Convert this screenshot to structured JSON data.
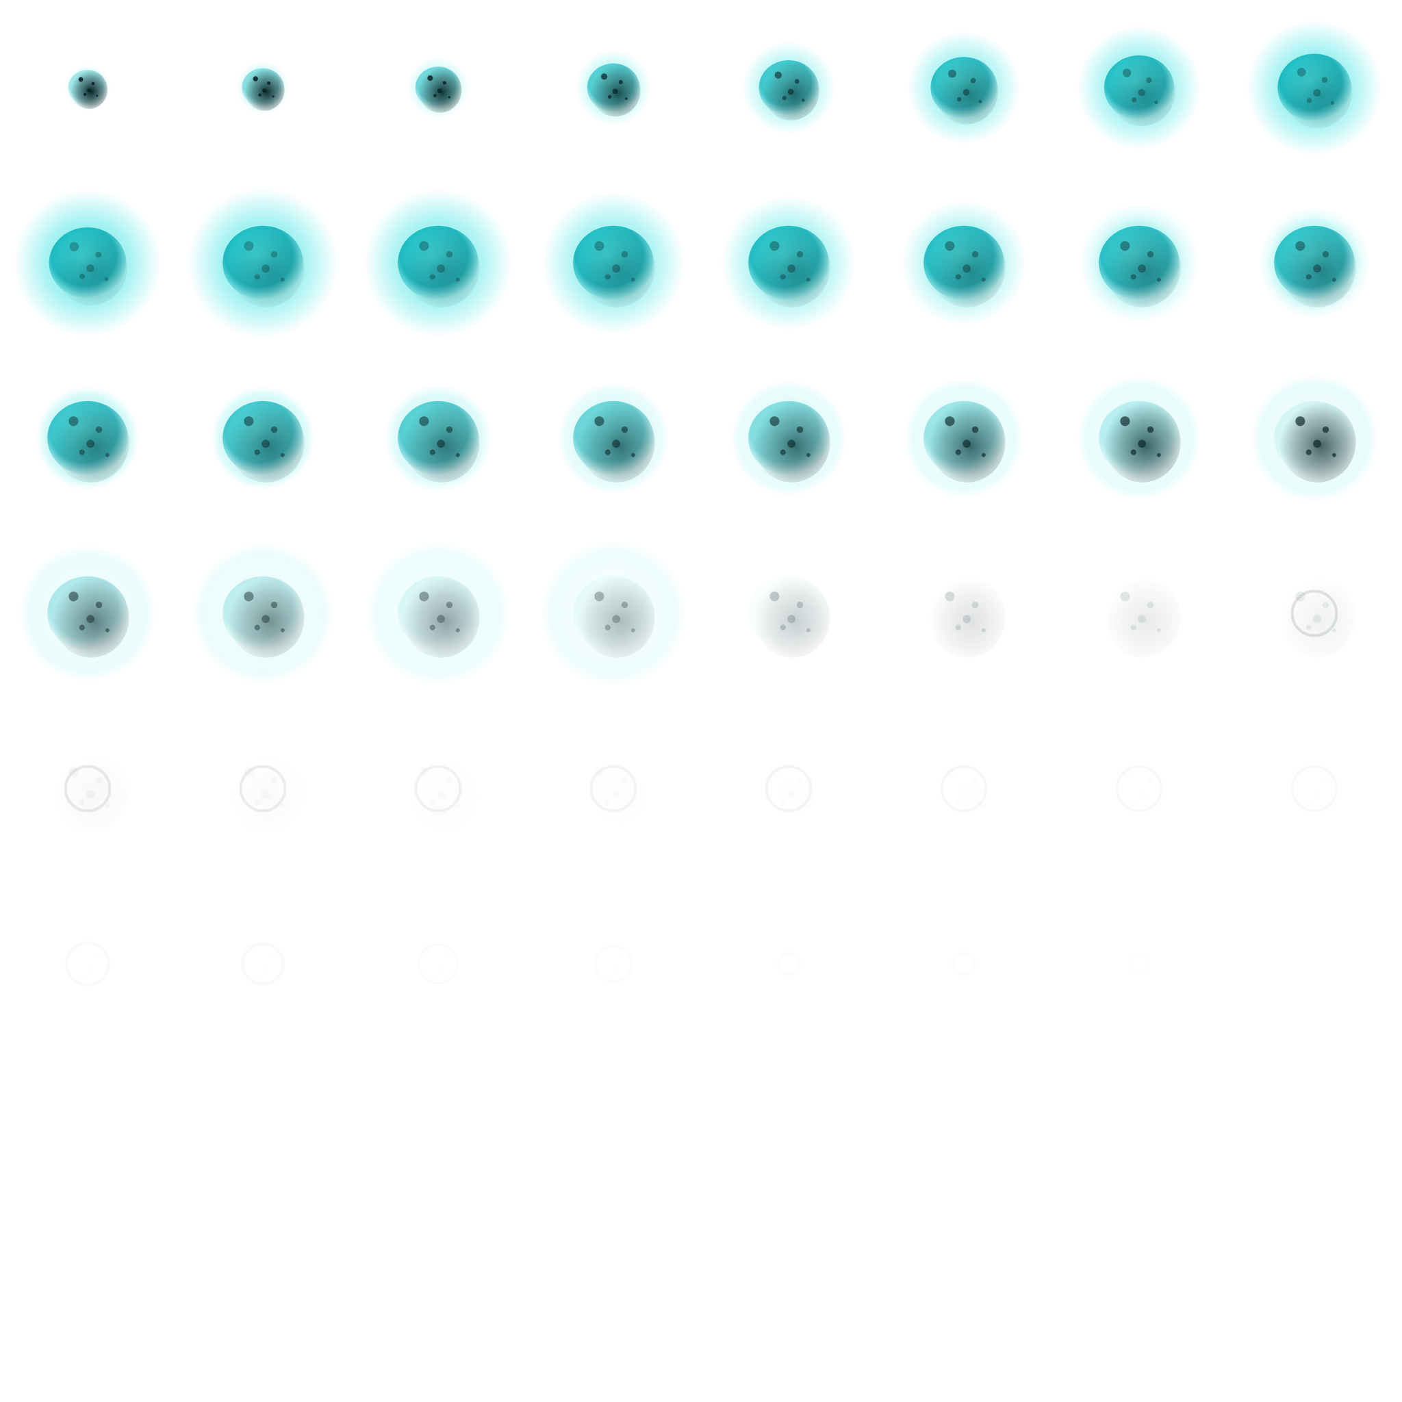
{
  "sprite_sheet": {
    "grid": {
      "columns": 8,
      "rows": 8
    },
    "frame_count": 55,
    "colors": {
      "glow": "#3fe3e3",
      "core": "#1fb8bf",
      "dark": "#0a2326",
      "smoke": "#2b3a3c",
      "background": "#ffffff"
    },
    "frames": [
      {
        "index": 0,
        "core": 0.22,
        "glow": 0.15,
        "ring": 0.0,
        "teal": 0.35,
        "dark": 1.0,
        "opacity": 1.0
      },
      {
        "index": 1,
        "core": 0.24,
        "glow": 0.2,
        "ring": 0.0,
        "teal": 0.45,
        "dark": 0.95,
        "opacity": 1.0
      },
      {
        "index": 2,
        "core": 0.26,
        "glow": 0.25,
        "ring": 0.0,
        "teal": 0.55,
        "dark": 0.9,
        "opacity": 1.0
      },
      {
        "index": 3,
        "core": 0.3,
        "glow": 0.32,
        "ring": 0.0,
        "teal": 0.7,
        "dark": 0.75,
        "opacity": 1.0
      },
      {
        "index": 4,
        "core": 0.34,
        "glow": 0.4,
        "ring": 0.0,
        "teal": 0.8,
        "dark": 0.6,
        "opacity": 1.0
      },
      {
        "index": 5,
        "core": 0.38,
        "glow": 0.5,
        "ring": 0.0,
        "teal": 0.9,
        "dark": 0.45,
        "opacity": 1.0
      },
      {
        "index": 6,
        "core": 0.4,
        "glow": 0.55,
        "ring": 0.0,
        "teal": 0.95,
        "dark": 0.35,
        "opacity": 1.0
      },
      {
        "index": 7,
        "core": 0.42,
        "glow": 0.6,
        "ring": 0.0,
        "teal": 1.0,
        "dark": 0.3,
        "opacity": 1.0
      },
      {
        "index": 8,
        "core": 0.44,
        "glow": 0.65,
        "ring": 0.0,
        "teal": 1.0,
        "dark": 0.28,
        "opacity": 1.0
      },
      {
        "index": 9,
        "core": 0.46,
        "glow": 0.62,
        "ring": 0.0,
        "teal": 1.0,
        "dark": 0.28,
        "opacity": 1.0
      },
      {
        "index": 10,
        "core": 0.46,
        "glow": 0.6,
        "ring": 0.0,
        "teal": 1.0,
        "dark": 0.3,
        "opacity": 1.0
      },
      {
        "index": 11,
        "core": 0.46,
        "glow": 0.55,
        "ring": 0.6,
        "teal": 0.98,
        "dark": 0.32,
        "opacity": 1.0
      },
      {
        "index": 12,
        "core": 0.46,
        "glow": 0.48,
        "ring": 0.63,
        "teal": 0.96,
        "dark": 0.35,
        "opacity": 1.0
      },
      {
        "index": 13,
        "core": 0.46,
        "glow": 0.4,
        "ring": 0.66,
        "teal": 0.94,
        "dark": 0.38,
        "opacity": 1.0
      },
      {
        "index": 14,
        "core": 0.46,
        "glow": 0.34,
        "ring": 0.7,
        "teal": 0.92,
        "dark": 0.4,
        "opacity": 1.0
      },
      {
        "index": 15,
        "core": 0.46,
        "glow": 0.28,
        "ring": 0.73,
        "teal": 0.9,
        "dark": 0.42,
        "opacity": 1.0
      },
      {
        "index": 16,
        "core": 0.46,
        "glow": 0.22,
        "ring": 0.77,
        "teal": 0.85,
        "dark": 0.45,
        "opacity": 1.0
      },
      {
        "index": 17,
        "core": 0.46,
        "glow": 0.18,
        "ring": 0.8,
        "teal": 0.8,
        "dark": 0.48,
        "opacity": 1.0
      },
      {
        "index": 18,
        "core": 0.46,
        "glow": 0.14,
        "ring": 0.83,
        "teal": 0.7,
        "dark": 0.52,
        "opacity": 1.0
      },
      {
        "index": 19,
        "core": 0.46,
        "glow": 0.1,
        "ring": 0.86,
        "teal": 0.6,
        "dark": 0.56,
        "opacity": 1.0
      },
      {
        "index": 20,
        "core": 0.46,
        "glow": 0.06,
        "ring": 0.89,
        "teal": 0.48,
        "dark": 0.6,
        "opacity": 1.0
      },
      {
        "index": 21,
        "core": 0.46,
        "glow": 0.04,
        "ring": 0.92,
        "teal": 0.36,
        "dark": 0.64,
        "opacity": 1.0
      },
      {
        "index": 22,
        "core": 0.46,
        "glow": 0.02,
        "ring": 0.95,
        "teal": 0.22,
        "dark": 0.68,
        "opacity": 1.0
      },
      {
        "index": 23,
        "core": 0.46,
        "glow": 0.0,
        "ring": 0.98,
        "teal": 0.12,
        "dark": 0.7,
        "opacity": 1.0
      },
      {
        "index": 24,
        "core": 0.46,
        "glow": 0.0,
        "ring": 1.05,
        "teal": 0.35,
        "dark": 0.6,
        "opacity": 0.9
      },
      {
        "index": 25,
        "core": 0.46,
        "glow": 0.0,
        "ring": 1.08,
        "teal": 0.28,
        "dark": 0.55,
        "opacity": 0.85
      },
      {
        "index": 26,
        "core": 0.46,
        "glow": 0.0,
        "ring": 1.1,
        "teal": 0.15,
        "dark": 0.5,
        "opacity": 0.78
      },
      {
        "index": 27,
        "core": 0.46,
        "glow": 0.0,
        "ring": 1.12,
        "teal": 0.08,
        "dark": 0.42,
        "opacity": 0.7
      },
      {
        "index": 28,
        "core": 0.46,
        "glow": 0.0,
        "ring": 0.0,
        "teal": 0.05,
        "dark": 0.35,
        "opacity": 0.6
      },
      {
        "index": 29,
        "core": 0.46,
        "glow": 0.0,
        "ring": 0.0,
        "teal": 0.0,
        "dark": 0.26,
        "opacity": 0.52
      },
      {
        "index": 30,
        "core": 0.46,
        "glow": 0.0,
        "ring": 0.0,
        "teal": 0.0,
        "dark": 0.2,
        "opacity": 0.45
      },
      {
        "index": 31,
        "core": 0.46,
        "glow": 0.0,
        "ring": 0.0,
        "teal": 0.0,
        "dark": 0.16,
        "opacity": 0.4
      },
      {
        "index": 32,
        "core": 0.46,
        "glow": 0.0,
        "ring": 0.0,
        "teal": 0.0,
        "dark": 0.1,
        "opacity": 0.3
      },
      {
        "index": 33,
        "core": 0.46,
        "glow": 0.0,
        "ring": 0.0,
        "teal": 0.0,
        "dark": 0.08,
        "opacity": 0.25
      },
      {
        "index": 34,
        "core": 0.46,
        "glow": 0.0,
        "ring": 0.0,
        "teal": 0.0,
        "dark": 0.06,
        "opacity": 0.2
      },
      {
        "index": 35,
        "core": 0.46,
        "glow": 0.0,
        "ring": 0.0,
        "teal": 0.0,
        "dark": 0.05,
        "opacity": 0.16
      },
      {
        "index": 36,
        "core": 0.46,
        "glow": 0.0,
        "ring": 0.0,
        "teal": 0.0,
        "dark": 0.04,
        "opacity": 0.14
      },
      {
        "index": 37,
        "core": 0.46,
        "glow": 0.0,
        "ring": 0.0,
        "teal": 0.0,
        "dark": 0.04,
        "opacity": 0.12
      },
      {
        "index": 38,
        "core": 0.46,
        "glow": 0.0,
        "ring": 0.0,
        "teal": 0.0,
        "dark": 0.03,
        "opacity": 0.1
      },
      {
        "index": 39,
        "core": 0.46,
        "glow": 0.0,
        "ring": 0.0,
        "teal": 0.0,
        "dark": 0.03,
        "opacity": 0.08
      },
      {
        "index": 40,
        "core": 0.44,
        "glow": 0.0,
        "ring": 0.0,
        "teal": 0.0,
        "dark": 0.03,
        "opacity": 0.08
      },
      {
        "index": 41,
        "core": 0.42,
        "glow": 0.0,
        "ring": 0.0,
        "teal": 0.0,
        "dark": 0.03,
        "opacity": 0.07
      },
      {
        "index": 42,
        "core": 0.4,
        "glow": 0.0,
        "ring": 0.0,
        "teal": 0.0,
        "dark": 0.02,
        "opacity": 0.06
      },
      {
        "index": 43,
        "core": 0.38,
        "glow": 0.0,
        "ring": 0.0,
        "teal": 0.0,
        "dark": 0.02,
        "opacity": 0.05
      },
      {
        "index": 44,
        "core": 0.22,
        "glow": 0.0,
        "ring": 0.0,
        "teal": 0.0,
        "dark": 0.02,
        "opacity": 0.04
      },
      {
        "index": 45,
        "core": 0.22,
        "glow": 0.0,
        "ring": 0.0,
        "teal": 0.0,
        "dark": 0.02,
        "opacity": 0.03
      },
      {
        "index": 46,
        "core": 0.18,
        "glow": 0.0,
        "ring": 0.0,
        "teal": 0.0,
        "dark": 0.01,
        "opacity": 0.02
      }
    ]
  }
}
